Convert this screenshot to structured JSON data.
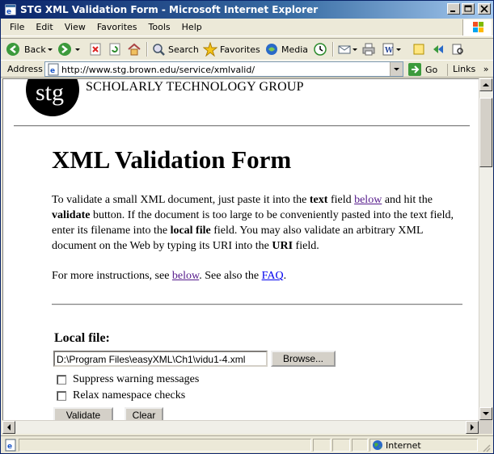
{
  "window": {
    "title": "STG XML Validation Form - Microsoft Internet Explorer"
  },
  "menu": {
    "items": [
      {
        "label": "File"
      },
      {
        "label": "Edit"
      },
      {
        "label": "View"
      },
      {
        "label": "Favorites"
      },
      {
        "label": "Tools"
      },
      {
        "label": "Help"
      }
    ]
  },
  "toolbar": {
    "back": "Back",
    "search": "Search",
    "favorites": "Favorites",
    "media": "Media"
  },
  "address": {
    "label": "Address",
    "url": "http://www.stg.brown.edu/service/xmlvalid/",
    "go": "Go",
    "links": "Links"
  },
  "page": {
    "logo_text": "stg",
    "org_name": "SCHOLARLY TECHNOLOGY GROUP",
    "title": "XML Validation Form",
    "intro": {
      "t1": "To validate a small XML document, just paste it into the ",
      "b1": "text",
      "t2": " field ",
      "link1": "below",
      "t3": " and hit the ",
      "b2": "validate",
      "t4": " button. If the document is too large to be conveniently pasted into the text field, enter its filename into the ",
      "b3": "local file",
      "t5": " field. You may also validate an arbitrary XML document on the Web by typing its URI into the ",
      "b4": "URI",
      "t6": " field."
    },
    "more": {
      "t1": "For more instructions, see ",
      "link1": "below",
      "t2": ". See also the ",
      "link2": "FAQ",
      "t3": "."
    },
    "local_file_label": "Local file:",
    "local_file_value": "D:\\Program Files\\easyXML\\Ch1\\vidu1-4.xml",
    "browse_label": "Browse...",
    "checkbox_suppress": "Suppress warning messages",
    "checkbox_relax": "Relax namespace checks",
    "validate_label": "Validate",
    "clear_label": "Clear"
  },
  "status": {
    "zone": "Internet"
  }
}
